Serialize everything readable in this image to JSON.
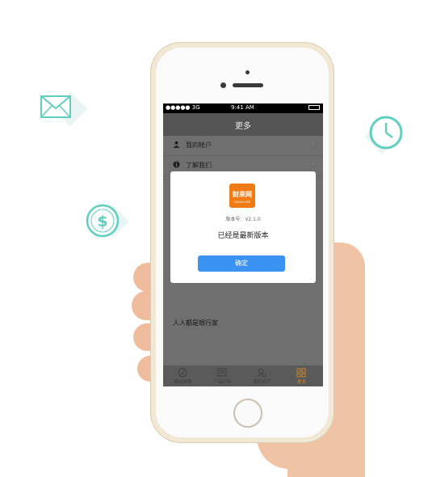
{
  "status_bar": {
    "signal": "●●●●● 3G",
    "time": "9:41 AM"
  },
  "nav": {
    "title": "更多"
  },
  "menu": [
    {
      "label": "我的帐户",
      "icon": "user-icon"
    },
    {
      "label": "了解我们",
      "icon": "info-icon"
    }
  ],
  "footer_text": "人人都是银行家",
  "tabs": [
    {
      "label": "精选推荐",
      "icon": "check-circle-icon"
    },
    {
      "label": "产品列表",
      "icon": "list-icon"
    },
    {
      "label": "我的资产",
      "icon": "user-assets-icon"
    },
    {
      "label": "更多",
      "icon": "grid-icon",
      "active": true
    }
  ],
  "dialog": {
    "logo_text": "财来网",
    "logo_subtext": "CAILAI.COM",
    "version": "版本号：V2.1.0",
    "message": "已经是最新版本",
    "ok_label": "确定"
  },
  "colors": {
    "accent": "#3a93f2",
    "logo": "#f07a13",
    "icon_teal": "#5fd0bd",
    "active_tab": "#c8852a"
  },
  "decorations": [
    "mail-icon",
    "dollar-icon",
    "clock-icon"
  ]
}
